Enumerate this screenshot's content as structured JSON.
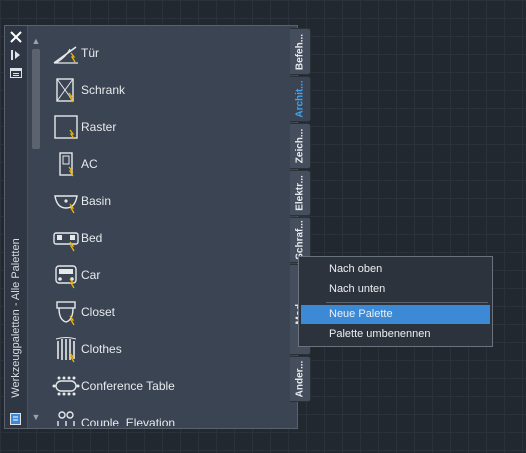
{
  "palette": {
    "title": "Werkzeugpaletten - Alle Paletten",
    "items": [
      {
        "label": "Tür",
        "icon": "door-icon"
      },
      {
        "label": "Schrank",
        "icon": "cabinet-icon"
      },
      {
        "label": "Raster",
        "icon": "grid-icon"
      },
      {
        "label": "AC",
        "icon": "ac-icon"
      },
      {
        "label": "Basin",
        "icon": "basin-icon"
      },
      {
        "label": "Bed",
        "icon": "bed-icon"
      },
      {
        "label": "Car",
        "icon": "car-icon"
      },
      {
        "label": "Closet",
        "icon": "closet-icon"
      },
      {
        "label": "Clothes",
        "icon": "clothes-icon"
      },
      {
        "label": "Conference Table",
        "icon": "conference-table-icon"
      },
      {
        "label": "Couple_Elevation",
        "icon": "couple-elevation-icon"
      }
    ]
  },
  "tabs": [
    {
      "label": "Befeh..."
    },
    {
      "label": "Archit..."
    },
    {
      "label": "Zeich..."
    },
    {
      "label": "Elektr..."
    },
    {
      "label": "Schraf..."
    },
    {
      "label": "Mod..."
    },
    {
      "label": "Ander..."
    }
  ],
  "context_menu": {
    "items": [
      {
        "label": "Nach oben"
      },
      {
        "label": "Nach unten"
      },
      {
        "label": "Neue Palette",
        "highlighted": true
      },
      {
        "label": "Palette umbenennen"
      }
    ]
  },
  "colors": {
    "accent": "#3c8ad6",
    "active_tab_text": "#42a4e8",
    "canvas_bg": "#212830",
    "palette_bg": "#3b4453"
  }
}
